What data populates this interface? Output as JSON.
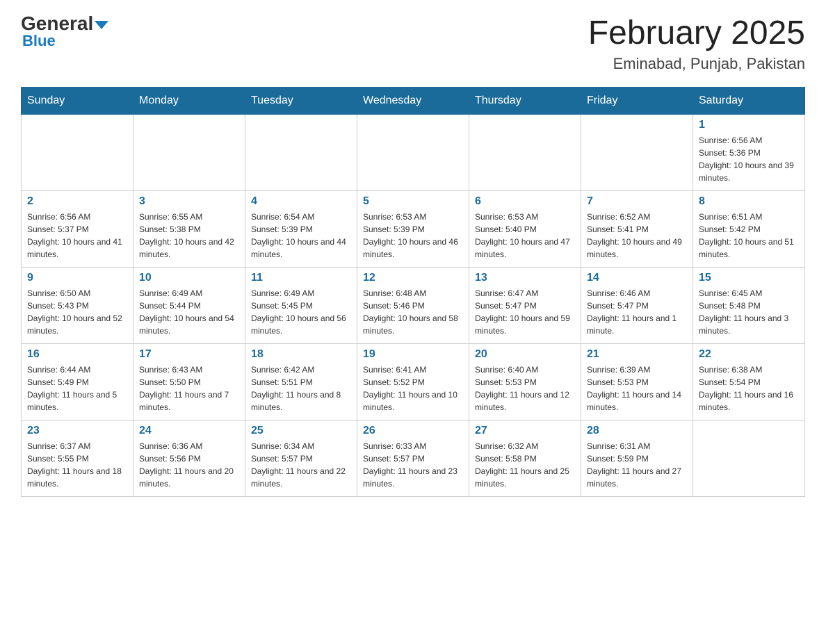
{
  "header": {
    "logo_general": "General",
    "logo_blue": "Blue",
    "title": "February 2025",
    "subtitle": "Eminabad, Punjab, Pakistan"
  },
  "weekdays": [
    "Sunday",
    "Monday",
    "Tuesday",
    "Wednesday",
    "Thursday",
    "Friday",
    "Saturday"
  ],
  "weeks": [
    [
      {
        "day": "",
        "sunrise": "",
        "sunset": "",
        "daylight": ""
      },
      {
        "day": "",
        "sunrise": "",
        "sunset": "",
        "daylight": ""
      },
      {
        "day": "",
        "sunrise": "",
        "sunset": "",
        "daylight": ""
      },
      {
        "day": "",
        "sunrise": "",
        "sunset": "",
        "daylight": ""
      },
      {
        "day": "",
        "sunrise": "",
        "sunset": "",
        "daylight": ""
      },
      {
        "day": "",
        "sunrise": "",
        "sunset": "",
        "daylight": ""
      },
      {
        "day": "1",
        "sunrise": "Sunrise: 6:56 AM",
        "sunset": "Sunset: 5:36 PM",
        "daylight": "Daylight: 10 hours and 39 minutes."
      }
    ],
    [
      {
        "day": "2",
        "sunrise": "Sunrise: 6:56 AM",
        "sunset": "Sunset: 5:37 PM",
        "daylight": "Daylight: 10 hours and 41 minutes."
      },
      {
        "day": "3",
        "sunrise": "Sunrise: 6:55 AM",
        "sunset": "Sunset: 5:38 PM",
        "daylight": "Daylight: 10 hours and 42 minutes."
      },
      {
        "day": "4",
        "sunrise": "Sunrise: 6:54 AM",
        "sunset": "Sunset: 5:39 PM",
        "daylight": "Daylight: 10 hours and 44 minutes."
      },
      {
        "day": "5",
        "sunrise": "Sunrise: 6:53 AM",
        "sunset": "Sunset: 5:39 PM",
        "daylight": "Daylight: 10 hours and 46 minutes."
      },
      {
        "day": "6",
        "sunrise": "Sunrise: 6:53 AM",
        "sunset": "Sunset: 5:40 PM",
        "daylight": "Daylight: 10 hours and 47 minutes."
      },
      {
        "day": "7",
        "sunrise": "Sunrise: 6:52 AM",
        "sunset": "Sunset: 5:41 PM",
        "daylight": "Daylight: 10 hours and 49 minutes."
      },
      {
        "day": "8",
        "sunrise": "Sunrise: 6:51 AM",
        "sunset": "Sunset: 5:42 PM",
        "daylight": "Daylight: 10 hours and 51 minutes."
      }
    ],
    [
      {
        "day": "9",
        "sunrise": "Sunrise: 6:50 AM",
        "sunset": "Sunset: 5:43 PM",
        "daylight": "Daylight: 10 hours and 52 minutes."
      },
      {
        "day": "10",
        "sunrise": "Sunrise: 6:49 AM",
        "sunset": "Sunset: 5:44 PM",
        "daylight": "Daylight: 10 hours and 54 minutes."
      },
      {
        "day": "11",
        "sunrise": "Sunrise: 6:49 AM",
        "sunset": "Sunset: 5:45 PM",
        "daylight": "Daylight: 10 hours and 56 minutes."
      },
      {
        "day": "12",
        "sunrise": "Sunrise: 6:48 AM",
        "sunset": "Sunset: 5:46 PM",
        "daylight": "Daylight: 10 hours and 58 minutes."
      },
      {
        "day": "13",
        "sunrise": "Sunrise: 6:47 AM",
        "sunset": "Sunset: 5:47 PM",
        "daylight": "Daylight: 10 hours and 59 minutes."
      },
      {
        "day": "14",
        "sunrise": "Sunrise: 6:46 AM",
        "sunset": "Sunset: 5:47 PM",
        "daylight": "Daylight: 11 hours and 1 minute."
      },
      {
        "day": "15",
        "sunrise": "Sunrise: 6:45 AM",
        "sunset": "Sunset: 5:48 PM",
        "daylight": "Daylight: 11 hours and 3 minutes."
      }
    ],
    [
      {
        "day": "16",
        "sunrise": "Sunrise: 6:44 AM",
        "sunset": "Sunset: 5:49 PM",
        "daylight": "Daylight: 11 hours and 5 minutes."
      },
      {
        "day": "17",
        "sunrise": "Sunrise: 6:43 AM",
        "sunset": "Sunset: 5:50 PM",
        "daylight": "Daylight: 11 hours and 7 minutes."
      },
      {
        "day": "18",
        "sunrise": "Sunrise: 6:42 AM",
        "sunset": "Sunset: 5:51 PM",
        "daylight": "Daylight: 11 hours and 8 minutes."
      },
      {
        "day": "19",
        "sunrise": "Sunrise: 6:41 AM",
        "sunset": "Sunset: 5:52 PM",
        "daylight": "Daylight: 11 hours and 10 minutes."
      },
      {
        "day": "20",
        "sunrise": "Sunrise: 6:40 AM",
        "sunset": "Sunset: 5:53 PM",
        "daylight": "Daylight: 11 hours and 12 minutes."
      },
      {
        "day": "21",
        "sunrise": "Sunrise: 6:39 AM",
        "sunset": "Sunset: 5:53 PM",
        "daylight": "Daylight: 11 hours and 14 minutes."
      },
      {
        "day": "22",
        "sunrise": "Sunrise: 6:38 AM",
        "sunset": "Sunset: 5:54 PM",
        "daylight": "Daylight: 11 hours and 16 minutes."
      }
    ],
    [
      {
        "day": "23",
        "sunrise": "Sunrise: 6:37 AM",
        "sunset": "Sunset: 5:55 PM",
        "daylight": "Daylight: 11 hours and 18 minutes."
      },
      {
        "day": "24",
        "sunrise": "Sunrise: 6:36 AM",
        "sunset": "Sunset: 5:56 PM",
        "daylight": "Daylight: 11 hours and 20 minutes."
      },
      {
        "day": "25",
        "sunrise": "Sunrise: 6:34 AM",
        "sunset": "Sunset: 5:57 PM",
        "daylight": "Daylight: 11 hours and 22 minutes."
      },
      {
        "day": "26",
        "sunrise": "Sunrise: 6:33 AM",
        "sunset": "Sunset: 5:57 PM",
        "daylight": "Daylight: 11 hours and 23 minutes."
      },
      {
        "day": "27",
        "sunrise": "Sunrise: 6:32 AM",
        "sunset": "Sunset: 5:58 PM",
        "daylight": "Daylight: 11 hours and 25 minutes."
      },
      {
        "day": "28",
        "sunrise": "Sunrise: 6:31 AM",
        "sunset": "Sunset: 5:59 PM",
        "daylight": "Daylight: 11 hours and 27 minutes."
      },
      {
        "day": "",
        "sunrise": "",
        "sunset": "",
        "daylight": ""
      }
    ]
  ]
}
